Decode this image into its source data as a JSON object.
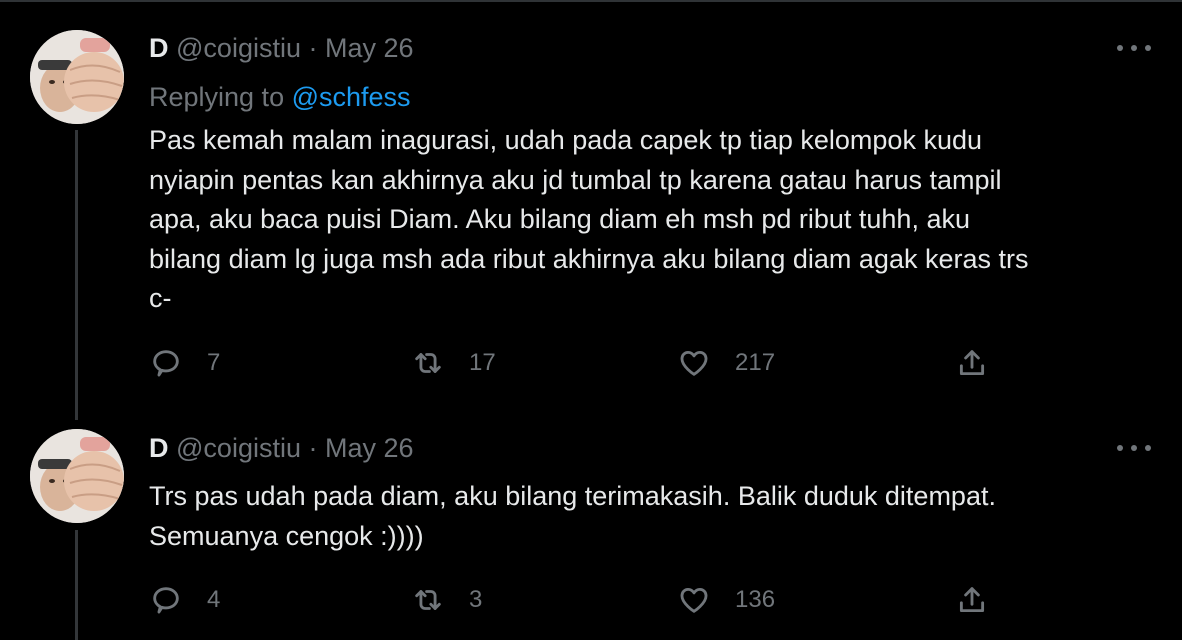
{
  "tweets": [
    {
      "display_name": "D",
      "handle": "@coigistiu",
      "separator": "·",
      "date": "May 26",
      "replying_prefix": "Replying to",
      "replying_to": "@schfess",
      "text": "Pas kemah malam inagurasi, udah pada capek tp tiap kelompok kudu\nnyiapin pentas kan akhirnya aku jd tumbal tp karena gatau harus tampil\napa, aku baca puisi Diam. Aku bilang diam eh msh pd ribut tuhh, aku\nbilang diam lg juga msh ada ribut akhirnya aku bilang diam agak keras trs\nc-",
      "replies": "7",
      "retweets": "17",
      "likes": "217"
    },
    {
      "display_name": "D",
      "handle": "@coigistiu",
      "separator": "·",
      "date": "May 26",
      "text": "Trs pas udah pada diam, aku bilang terimakasih. Balik duduk ditempat.\nSemuanya cengok :))))",
      "replies": "4",
      "retweets": "3",
      "likes": "136"
    }
  ],
  "icons": {
    "reply": "reply-icon",
    "retweet": "retweet-icon",
    "like": "heart-icon",
    "share": "share-icon",
    "more": "more-horizontal-icon"
  },
  "colors": {
    "background": "#000000",
    "text": "#e7e9ea",
    "secondary": "#71767b",
    "accent": "#1d9bf0"
  }
}
